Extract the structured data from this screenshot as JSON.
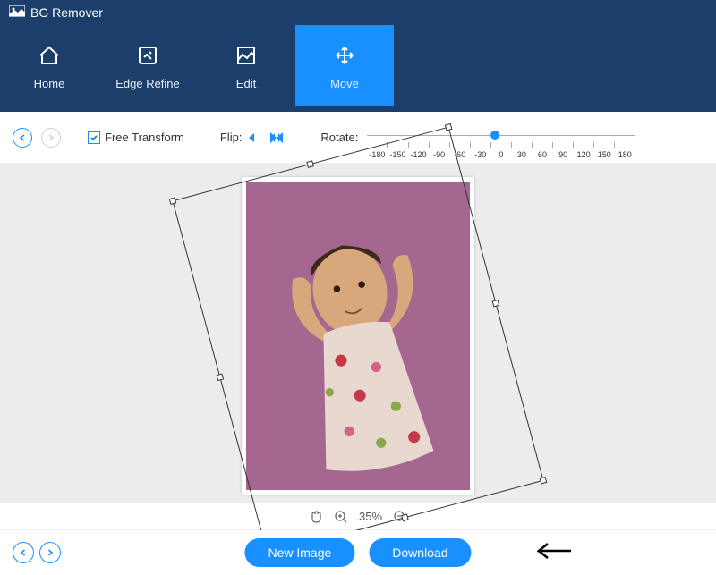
{
  "app": {
    "title": "BG Remover"
  },
  "nav": {
    "items": [
      {
        "label": "Home",
        "icon": "home-icon"
      },
      {
        "label": "Edge Refine",
        "icon": "edge-refine-icon"
      },
      {
        "label": "Edit",
        "icon": "edit-icon"
      },
      {
        "label": "Move",
        "icon": "move-icon"
      }
    ],
    "active": "Move"
  },
  "toolbar": {
    "free_transform_label": "Free Transform",
    "free_transform_checked": true,
    "flip_label": "Flip:",
    "rotate_label": "Rotate:",
    "rotate_ticks": [
      "-180",
      "-150",
      "-120",
      "-90",
      "-60",
      "-30",
      "0",
      "30",
      "60",
      "90",
      "120",
      "150",
      "180"
    ],
    "rotate_value": -30
  },
  "canvas": {
    "background_color": "#a56790",
    "transform_rotation_deg": -15
  },
  "zoom": {
    "percent_text": "35%"
  },
  "bottom": {
    "new_image_label": "New Image",
    "download_label": "Download"
  }
}
